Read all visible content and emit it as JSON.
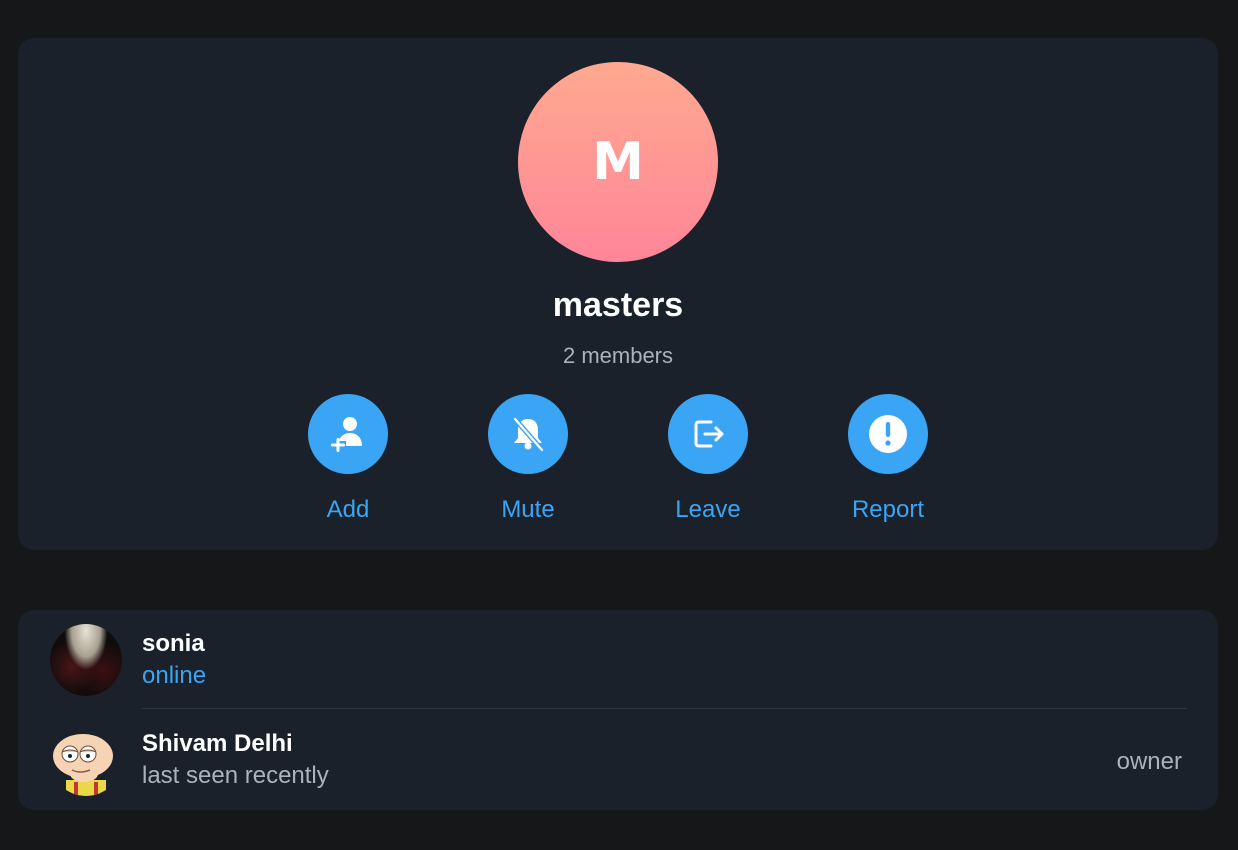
{
  "group": {
    "avatar_letter": "M",
    "avatar_gradient": [
      "#ffa98f",
      "#ff8599"
    ],
    "name": "masters",
    "member_count_text": "2 members"
  },
  "actions": [
    {
      "label": "Add",
      "icon": "add-user-icon"
    },
    {
      "label": "Mute",
      "icon": "bell-off-icon"
    },
    {
      "label": "Leave",
      "icon": "leave-icon"
    },
    {
      "label": "Report",
      "icon": "report-icon"
    }
  ],
  "members": [
    {
      "name": "sonia",
      "status": "online",
      "avatar": "photo",
      "role": ""
    },
    {
      "name": "Shivam Delhi",
      "status": "last seen recently",
      "avatar": "cartoon",
      "role": "owner"
    }
  ],
  "colors": {
    "background": "#151719",
    "card": "#1a212b",
    "accent": "#3aa5f5",
    "secondary_text": "#a9b2bd"
  }
}
